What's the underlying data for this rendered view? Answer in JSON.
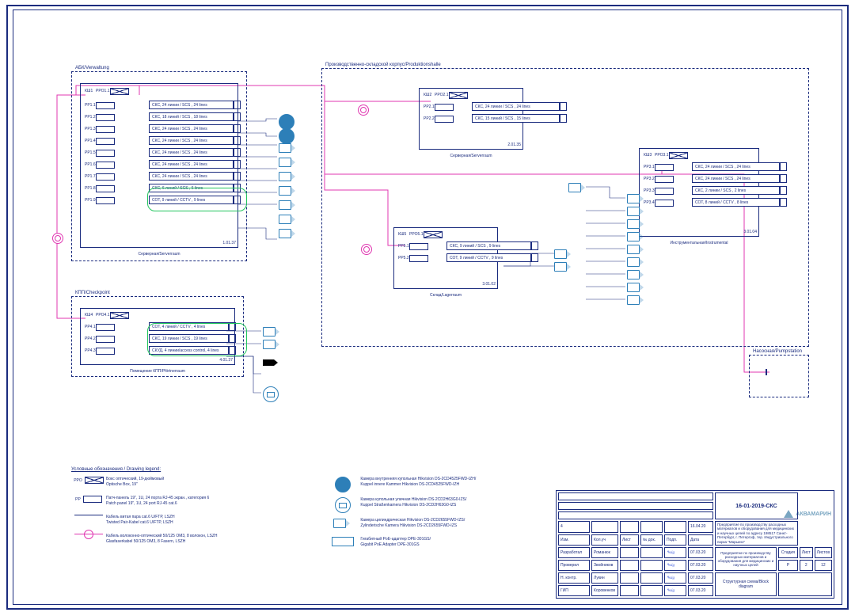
{
  "doc_number": "16-01-2019-СКС",
  "drawing_title": "Структурная схема/Block diagram",
  "project_line1": "Предприятие по производству расходных материалов и оборудования для медицинских и научных целей по адресу 198517 Санкт-Петербург, г. Петергоф, тер. Индустриального парка \"Марьино\"",
  "project_line2": "Предприятие по производству расходных материалов и оборудования для медицинских и научных целей",
  "cols": {
    "stage": "Стадия",
    "sheet": "Лист",
    "sheets": "Листов",
    "stage_v": "Р",
    "sheet_v": "2",
    "sheets_v": "12"
  },
  "tb_rows": [
    {
      "n": "4",
      "a": "",
      "b": "",
      "c": "",
      "d": "",
      "date": "16.04.20"
    },
    {
      "n": "Изм.",
      "a": "Кол.уч",
      "b": "Лист",
      "c": "№ док.",
      "d": "Подп.",
      "date": "Дата"
    },
    {
      "n": "Разработал",
      "a": "Романюк",
      "b": "",
      "c": "",
      "d": "sig",
      "date": "07.03.20"
    },
    {
      "n": "Проверил",
      "a": "Звойников",
      "b": "",
      "c": "",
      "d": "sig",
      "date": "07.03.20"
    },
    {
      "n": "Н. контр.",
      "a": "Лукин",
      "b": "",
      "c": "",
      "d": "sig",
      "date": "07.03.20"
    },
    {
      "n": "ГИП",
      "a": "Коровенков",
      "b": "",
      "c": "",
      "d": "sig",
      "date": "07.03.20"
    }
  ],
  "legend_title": "Условные обозначения / Drawing legend:",
  "legend_left": [
    {
      "sym": "xbox",
      "pre": "PPO",
      "t": "Бокс оптический, 19-дюймовый\nOptische Box, 19\""
    },
    {
      "sym": "box",
      "pre": "PP",
      "t": "Патч-панель 19\", 1U, 24 порта RJ-45 экран., категория 6\nPatch panel 19\", 1U, 24 port RJ-45 cat.6"
    },
    {
      "sym": "line",
      "t": "Кабель витая пара cat.6 U/FTP, LSZH\nTwisted Pair-Kabel cat.6 U/FTP, LSZH"
    },
    {
      "sym": "pink",
      "t": "Кабель волоконно-оптический 50/125 ОМ3, 8 волокон, LSZH\nGlasfaserkabel 50/125 ОМ3, 8 Fasern, LSZH"
    }
  ],
  "legend_right": [
    {
      "sym": "dome-solid",
      "t": "Камера внутренняя купольная Hikvision DS-2CD4525FWD-IZH/\nKuppel innere Kammer Hikvision DS-2CD4525FWD-IZH"
    },
    {
      "sym": "dome",
      "t": "Камера купольная уличная Hikvision DS-2CD2H63G0-IZS/\nKuppel Straßenkamera Hikvision DS-2CD2H63G0-IZS"
    },
    {
      "sym": "cam",
      "t": "Камера цилиндрическая Hikvision DS-2CD2655FWD-IZS/\nZylinderische Kamera Hikvision DS-2CD2655FWD-IZS"
    },
    {
      "sym": "poe",
      "t": "Гигабитный PoE-адаптер DPE-301GS/\nGigabit PoE Adapter DPE-301GS"
    }
  ],
  "b1": {
    "label": "АБК/Verwaltung",
    "room": "Серверная/Serverraum",
    "num": "1.01.37",
    "kname": "КШ1",
    "ppo": "PPO1.1",
    "rows": [
      {
        "tag": "PP1.1",
        "t": "СКС, 24 линии / SCS , 24 lines"
      },
      {
        "tag": "PP1.2",
        "t": "СКС, 18 линий / SCS , 18 lines"
      },
      {
        "tag": "PP1.3",
        "t": "СКС, 24 линии / SCS , 24 lines"
      },
      {
        "tag": "PP1.4",
        "t": "СКС, 24 линии / SCS , 24 lines"
      },
      {
        "tag": "PP1.5",
        "t": "СКС, 24 линии / SCS , 24 lines"
      },
      {
        "tag": "PP1.6",
        "t": "СКС, 24 линии / SCS , 24 lines"
      },
      {
        "tag": "PP1.7",
        "t": "СКС, 24 линии / SCS , 24 lines"
      },
      {
        "tag": "PP1.8",
        "t": "СКС, 6 линий / SCS , 6 lines"
      },
      {
        "tag": "PP1.9",
        "t": "СОТ, 9 линий / CCTV , 9 lines"
      }
    ]
  },
  "b2": {
    "label": "КПП/Checkpoint",
    "room": "Помещение КПП/Pförtnerraum",
    "num": "4.01.37",
    "kname": "КШ4",
    "ppo": "PPO4.1",
    "rows": [
      {
        "tag": "PP4.1",
        "t": "СОТ, 4 линий / CCTV , 4 lines"
      },
      {
        "tag": "PP4.2",
        "t": "СКС, 19 линии / SCS , 19 lines"
      },
      {
        "tag": "PP4.3",
        "t": "СКУД, 4 линии/access control, 4 lines"
      }
    ]
  },
  "b3": {
    "label": "Производственно-складской корпус/Produktionshalle",
    "roomA": {
      "name": "Серверная/Serverraum",
      "num": "2.01.35",
      "kname": "КШ2",
      "ppo": "PPO2.1",
      "rows": [
        {
          "tag": "PP2.1",
          "t": "СКС, 24 линии / SCS , 24 lines"
        },
        {
          "tag": "PP2.2",
          "t": "СКС, 15 линий / SCS , 15 lines"
        }
      ]
    },
    "roomB": {
      "name": "Склад/Lagerraum",
      "num": "3.01.02",
      "kname": "КШ5",
      "ppo": "PPO5.1",
      "rows": [
        {
          "tag": "PP5.1",
          "t": "СКС, 9 линий / SCS , 9 lines"
        },
        {
          "tag": "PP5.2",
          "t": "СОТ, 9 линий / CCTV , 9 lines"
        }
      ]
    },
    "roomC": {
      "name": "Инструментальная/Instrumental",
      "num": "3.01.04",
      "kname": "КШ3",
      "ppo": "PPO3.1",
      "rows": [
        {
          "tag": "PP3.1",
          "t": "СКС, 24 линии / SCS , 24 lines"
        },
        {
          "tag": "PP3.2",
          "t": "СКС, 24 линии / SCS , 24 lines"
        },
        {
          "tag": "PP3.3",
          "t": "СКС, 2 линии / SCS , 2 lines"
        },
        {
          "tag": "PP3.4",
          "t": "СОТ, 8 линий / CCTV , 8 lines"
        }
      ]
    }
  },
  "b4": {
    "label": "Насосная/Pumpstation"
  }
}
